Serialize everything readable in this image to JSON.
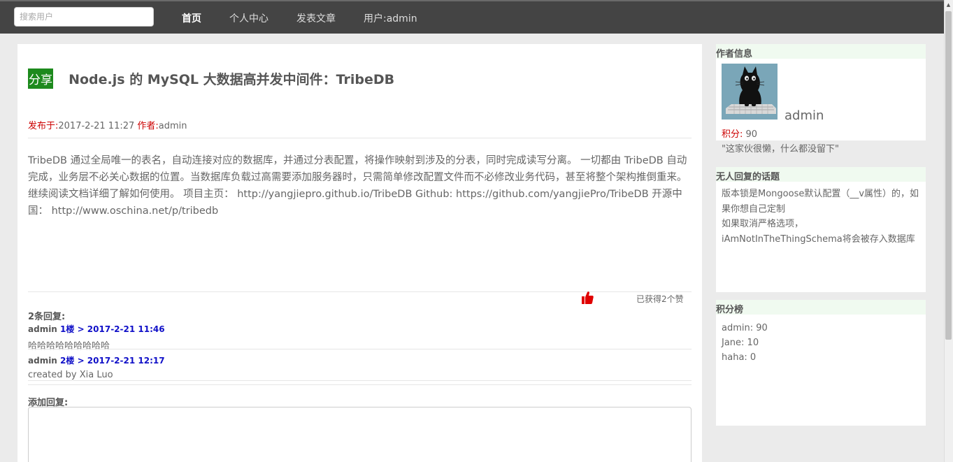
{
  "nav": {
    "search_placeholder": "搜索用户",
    "items": [
      {
        "label": "首页"
      },
      {
        "label": "个人中心"
      },
      {
        "label": "发表文章"
      },
      {
        "label": "用户:admin"
      }
    ]
  },
  "post": {
    "badge": "分享",
    "title": "Node.js 的 MySQL 大数据高并发中间件：TribeDB",
    "meta_published_label": "发布于:",
    "meta_published_value": "2017-2-21 11:27",
    "meta_author_label": "作者:",
    "meta_author_value": "admin",
    "body": "TribeDB 通过全局唯一的表名，自动连接对应的数据库，并通过分表配置，将操作映射到涉及的分表，同时完成读写分离。 一切都由 TribeDB 自动完成，业务层不必关心数据的位置。当数据库负载过高需要添加服务器时，只需简单修改配置文件而不必修改业务代码，甚至将整个架构推倒重来。继续阅读文档详细了解如何使用。 项目主页： http://yangjiepro.github.io/TribeDB Github: https://github.com/yangjiePro/TribeDB 开源中国： http://www.oschina.net/p/tribedb",
    "likes_text": "已获得2个赞",
    "like_icon": "thumbs-up-icon"
  },
  "replies": {
    "count_label": "2条回复:",
    "items": [
      {
        "author": "admin",
        "floor": "1楼 > 2017-2-21 11:46",
        "content": "哈哈哈哈哈哈哈哈哈"
      },
      {
        "author": "admin",
        "floor": "2楼 > 2017-2-21 12:17",
        "content": "created by Xia Luo"
      }
    ],
    "add_label": "添加回复:"
  },
  "sidebar": {
    "author_panel": {
      "title": "作者信息",
      "name": "admin",
      "score_label": "积分:",
      "score_value": "90",
      "motto": "\"这家伙很懒，什么都没留下\""
    },
    "unanswered_panel": {
      "title": "无人回复的话题",
      "topics": [
        "版本锁是Mongoose默认配置（__v属性）的，如果你想自己定制",
        "如果取消严格选项，iAmNotInTheThingSchema将会被存入数据库"
      ]
    },
    "rank_panel": {
      "title": "积分榜",
      "items": [
        "admin: 90",
        "Jane: 10",
        "haha: 0"
      ]
    }
  },
  "colors": {
    "nav_bg": "#444444",
    "badge_bg": "#1d8a1d",
    "label_red": "#cc0000",
    "reply_floor_blue": "#1010c8",
    "panel_head_bg": "#f0faf0"
  }
}
